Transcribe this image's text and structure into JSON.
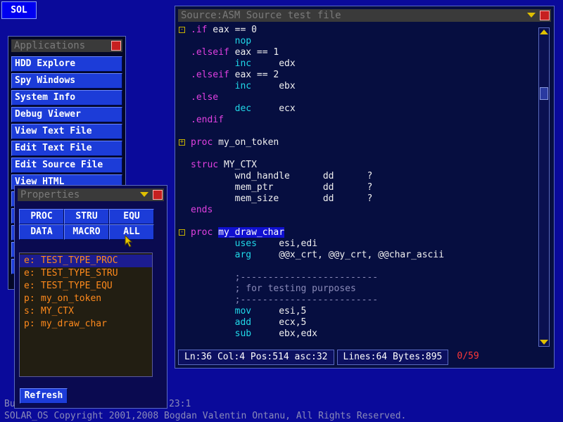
{
  "desktop": {
    "sol_label": "SOL",
    "footer": "SOLAR_OS Copyright 2001,2008 Bogdan Valentin Ontanu, All Rights Reserved.",
    "frag_left": "Bu",
    "frag_mid": "23:1"
  },
  "applications": {
    "title": "Applications",
    "items": [
      "HDD Explore",
      "Spy Windows",
      "System Info",
      "Debug Viewer",
      "View Text File",
      "Edit Text File",
      "Edit Source File",
      "View HTML"
    ]
  },
  "properties": {
    "title": "Properties",
    "filters": [
      [
        "PROC",
        "STRU",
        "EQU"
      ],
      [
        "DATA",
        "MACRO",
        "ALL"
      ]
    ],
    "active_filter": "ALL",
    "items": [
      {
        "kind": "e:",
        "name": "TEST_TYPE_PROC",
        "selected": true
      },
      {
        "kind": "e:",
        "name": "TEST_TYPE_STRU",
        "selected": false
      },
      {
        "kind": "e:",
        "name": "TEST_TYPE_EQU",
        "selected": false
      },
      {
        "kind": "p:",
        "name": "my_on_token",
        "selected": false
      },
      {
        "kind": "s:",
        "name": "MY_CTX",
        "selected": false
      },
      {
        "kind": "p:",
        "name": "my_draw_char",
        "selected": false
      }
    ],
    "refresh_label": "Refresh"
  },
  "source": {
    "title": "Source:ASM Source test file",
    "lines": [
      {
        "fold": "-",
        "t": [
          [
            ".if",
            "kw"
          ],
          [
            " eax == 0",
            "plain"
          ]
        ]
      },
      {
        "fold": "",
        "t": [
          [
            "        nop",
            "ins"
          ]
        ]
      },
      {
        "fold": "",
        "t": [
          [
            ".elseif",
            "kw"
          ],
          [
            " eax == 1",
            "plain"
          ]
        ]
      },
      {
        "fold": "",
        "t": [
          [
            "        inc",
            "ins"
          ],
          [
            "     edx",
            "plain"
          ]
        ]
      },
      {
        "fold": "",
        "t": [
          [
            ".elseif",
            "kw"
          ],
          [
            " eax == 2",
            "plain"
          ]
        ]
      },
      {
        "fold": "",
        "t": [
          [
            "        inc",
            "ins"
          ],
          [
            "     ebx",
            "plain"
          ]
        ]
      },
      {
        "fold": "",
        "t": [
          [
            ".else",
            "kw"
          ]
        ]
      },
      {
        "fold": "",
        "t": [
          [
            "        dec",
            "ins"
          ],
          [
            "     ecx",
            "plain"
          ]
        ]
      },
      {
        "fold": "",
        "t": [
          [
            ".endif",
            "kw"
          ]
        ]
      },
      {
        "fold": "",
        "t": []
      },
      {
        "fold": "+",
        "t": [
          [
            "proc",
            "kw"
          ],
          [
            " my_on_token",
            "plain"
          ]
        ]
      },
      {
        "fold": "",
        "t": []
      },
      {
        "fold": "",
        "t": [
          [
            "struc",
            "kw"
          ],
          [
            " MY_CTX",
            "plain"
          ]
        ]
      },
      {
        "fold": "",
        "t": [
          [
            "        wnd_handle      dd      ?",
            "plain"
          ]
        ]
      },
      {
        "fold": "",
        "t": [
          [
            "        mem_ptr         dd      ?",
            "plain"
          ]
        ]
      },
      {
        "fold": "",
        "t": [
          [
            "        mem_size        dd      ?",
            "plain"
          ]
        ]
      },
      {
        "fold": "",
        "t": [
          [
            "ends",
            "kw"
          ]
        ]
      },
      {
        "fold": "",
        "t": []
      },
      {
        "fold": "-",
        "t": [
          [
            "proc",
            "kw"
          ],
          [
            " ",
            "plain"
          ],
          [
            "my_draw_char",
            "hl"
          ]
        ]
      },
      {
        "fold": "",
        "t": [
          [
            "        uses",
            "ins"
          ],
          [
            "    esi,edi",
            "plain"
          ]
        ]
      },
      {
        "fold": "",
        "t": [
          [
            "        arg",
            "ins"
          ],
          [
            "     @@x_crt, @@y_crt, @@char_ascii",
            "plain"
          ]
        ]
      },
      {
        "fold": "",
        "t": []
      },
      {
        "fold": "",
        "t": [
          [
            "        ;-------------------------",
            "cm"
          ]
        ]
      },
      {
        "fold": "",
        "t": [
          [
            "        ; for testing purposes",
            "cm"
          ]
        ]
      },
      {
        "fold": "",
        "t": [
          [
            "        ;-------------------------",
            "cm"
          ]
        ]
      },
      {
        "fold": "",
        "t": [
          [
            "        mov",
            "ins"
          ],
          [
            "     esi,5",
            "plain"
          ]
        ]
      },
      {
        "fold": "",
        "t": [
          [
            "        add",
            "ins"
          ],
          [
            "     ecx,5",
            "plain"
          ]
        ]
      },
      {
        "fold": "",
        "t": [
          [
            "        sub",
            "ins"
          ],
          [
            "     ebx,edx",
            "plain"
          ]
        ]
      }
    ],
    "status": {
      "position": "Ln:36 Col:4 Pos:514 asc:32",
      "counts": "Lines:64 Bytes:895",
      "errors": "0/59"
    }
  }
}
